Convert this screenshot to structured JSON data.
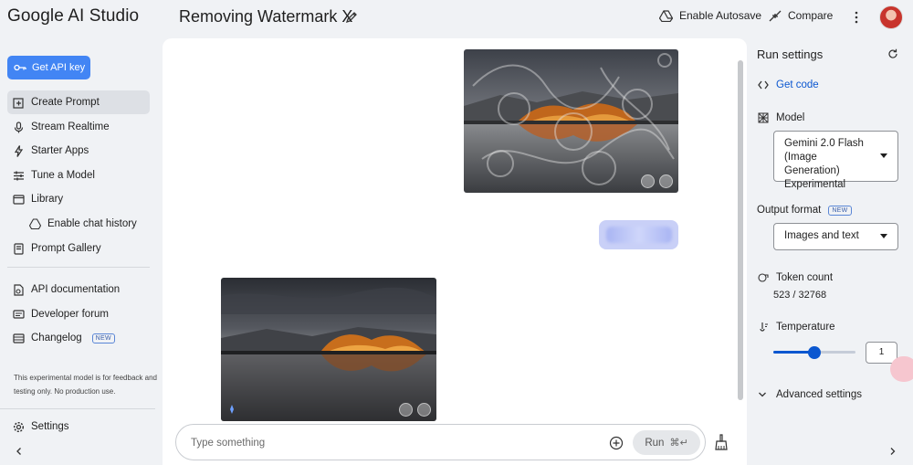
{
  "app": {
    "brand": "Google AI Studio",
    "doc_title": "Removing Watermark X"
  },
  "header": {
    "autosave_label": "Enable Autosave",
    "compare_label": "Compare"
  },
  "sidebar": {
    "api_key_label": "Get API key",
    "items": [
      {
        "label": "Create Prompt"
      },
      {
        "label": "Stream Realtime"
      },
      {
        "label": "Starter Apps"
      },
      {
        "label": "Tune a Model"
      },
      {
        "label": "Library"
      },
      {
        "label": "Enable chat history"
      },
      {
        "label": "Prompt Gallery"
      },
      {
        "label": "API documentation"
      },
      {
        "label": "Developer forum"
      },
      {
        "label": "Changelog",
        "badge": "NEW"
      },
      {
        "label": "Settings"
      }
    ],
    "note": "This experimental model is for feedback and testing only. No production use."
  },
  "chat": {
    "input_placeholder": "Type something",
    "run_label": "Run",
    "run_shortcut": "⌘↵"
  },
  "run_settings": {
    "title": "Run settings",
    "get_code_label": "Get code",
    "model_label": "Model",
    "model_value": "Gemini 2.0 Flash (Image Generation) Experimental",
    "output_format_label": "Output format",
    "output_format_badge": "NEW",
    "output_format_value": "Images and text",
    "token_count_label": "Token count",
    "token_count_value": "523 / 32768",
    "temperature_label": "Temperature",
    "temperature_value": "1",
    "temperature_fraction": 0.5,
    "advanced_label": "Advanced settings"
  },
  "colors": {
    "accent": "#0b57d0",
    "api_button": "#4285f4",
    "panel_bg": "#f0f2f5"
  }
}
